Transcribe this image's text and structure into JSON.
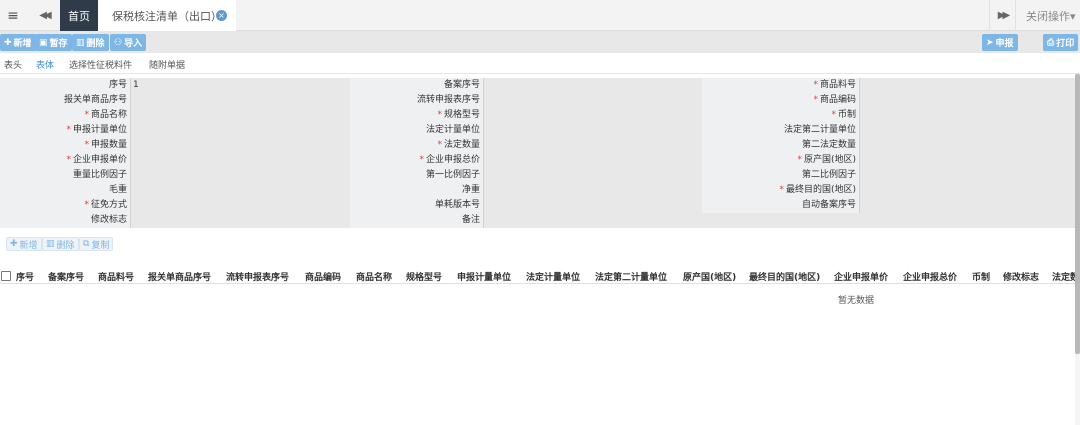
{
  "topbar": {
    "menu_icon": "≡",
    "prev_icon": "◀◀",
    "home_tab": "首页",
    "active_tab": "保税核注清单（出口）",
    "close_icon": "×",
    "next_icon": "▶▶",
    "close_ops": "关闭操作▾"
  },
  "toolbar": {
    "add": "新增",
    "save": "暂存",
    "delete": "删除",
    "import": "导入",
    "declare": "申报",
    "print": "打印"
  },
  "subtabs": [
    "表头",
    "表体",
    "选择性征税料件",
    "随附单据"
  ],
  "form": {
    "rows": [
      [
        {
          "label": "序号",
          "req": false,
          "value": "1"
        },
        {
          "label": "备案序号",
          "req": false,
          "value": ""
        },
        {
          "label": "商品料号",
          "req": true,
          "value": ""
        }
      ],
      [
        {
          "label": "报关单商品序号",
          "req": false,
          "value": ""
        },
        {
          "label": "流转申报表序号",
          "req": false,
          "value": ""
        },
        {
          "label": "商品编码",
          "req": true,
          "value": ""
        }
      ],
      [
        {
          "label": "商品名称",
          "req": true,
          "value": ""
        },
        {
          "label": "规格型号",
          "req": true,
          "value": ""
        },
        {
          "label": "币制",
          "req": true,
          "value": ""
        }
      ],
      [
        {
          "label": "申报计量单位",
          "req": true,
          "value": ""
        },
        {
          "label": "法定计量单位",
          "req": false,
          "value": ""
        },
        {
          "label": "法定第二计量单位",
          "req": false,
          "value": ""
        }
      ],
      [
        {
          "label": "申报数量",
          "req": true,
          "value": ""
        },
        {
          "label": "法定数量",
          "req": true,
          "value": ""
        },
        {
          "label": "第二法定数量",
          "req": false,
          "value": ""
        }
      ],
      [
        {
          "label": "企业申报单价",
          "req": true,
          "value": ""
        },
        {
          "label": "企业申报总价",
          "req": true,
          "value": ""
        },
        {
          "label": "原产国(地区)",
          "req": true,
          "value": ""
        }
      ],
      [
        {
          "label": "重量比例因子",
          "req": false,
          "value": ""
        },
        {
          "label": "第一比例因子",
          "req": false,
          "value": ""
        },
        {
          "label": "第二比例因子",
          "req": false,
          "value": ""
        }
      ],
      [
        {
          "label": "毛重",
          "req": false,
          "value": ""
        },
        {
          "label": "净重",
          "req": false,
          "value": ""
        },
        {
          "label": "最终目的国(地区)",
          "req": true,
          "value": ""
        }
      ],
      [
        {
          "label": "征免方式",
          "req": true,
          "value": ""
        },
        {
          "label": "单耗版本号",
          "req": false,
          "value": ""
        },
        {
          "label": "自动备案序号",
          "req": false,
          "value": ""
        }
      ],
      [
        {
          "label": "修改标志",
          "req": false,
          "value": ""
        },
        {
          "label": "备注",
          "req": false,
          "value": ""
        }
      ]
    ]
  },
  "detail_toolbar": {
    "add": "新增",
    "delete": "删除",
    "copy": "复制"
  },
  "table": {
    "headers": [
      "序号",
      "备案序号",
      "商品料号",
      "报关单商品序号",
      "流转申报表序号",
      "商品编码",
      "商品名称",
      "规格型号",
      "申报计量单位",
      "法定计量单位",
      "法定第二计量单位",
      "原产国(地区)",
      "最终目的国(地区)",
      "企业申报单价",
      "企业申报总价",
      "币制",
      "修改标志",
      "法定数"
    ],
    "empty_text": "暂无数据"
  },
  "colors": {
    "accent": "#7eb6e6",
    "home_tab_bg": "#2f3b49",
    "required": "#e53935"
  }
}
